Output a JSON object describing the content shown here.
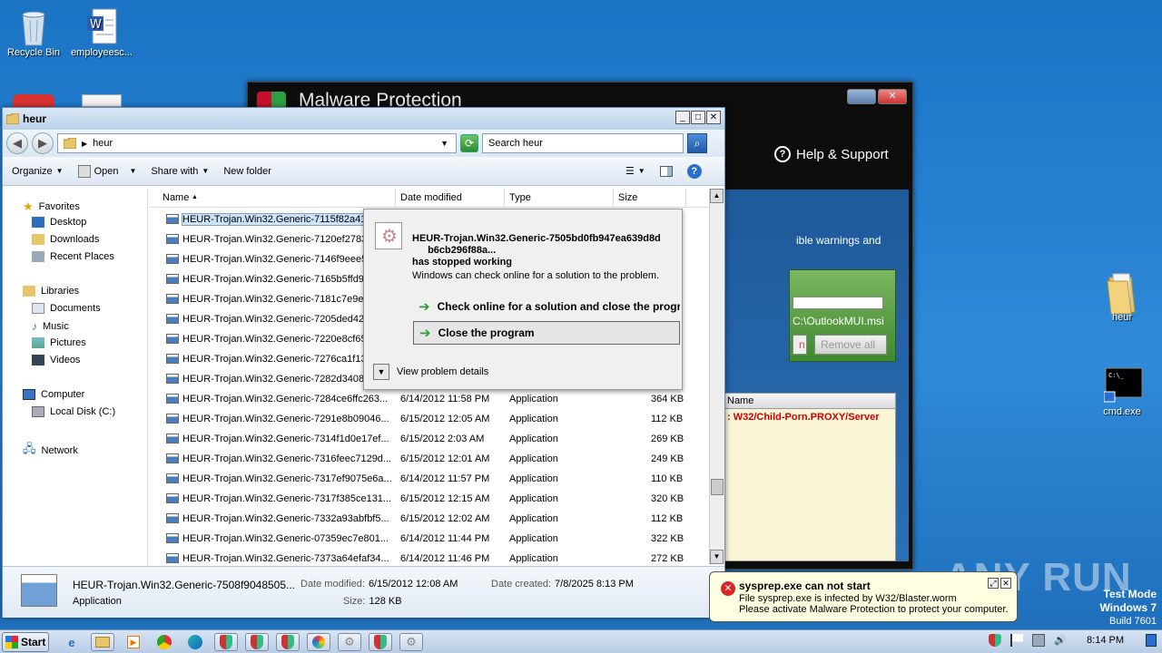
{
  "desktop": {
    "icons": [
      {
        "label": "Recycle Bin"
      },
      {
        "label": "employeesc..."
      },
      {
        "label": "heur"
      },
      {
        "label": "cmd.exe"
      }
    ]
  },
  "malware_window": {
    "title": "Malware Protection",
    "help": "Help & Support",
    "warning_text": "ible warnings and",
    "path_text": "C:\\OutlookMUI.msi",
    "btn_partial": "n",
    "btn_remove_all": "Remove all",
    "table_header": "Name",
    "threat_row": ": W32/Child-Porn.PROXY/Server"
  },
  "explorer": {
    "title": "heur",
    "address": "heur",
    "search_placeholder": "Search heur",
    "toolbar": {
      "organize": "Organize",
      "open": "Open",
      "share_with": "Share with",
      "new_folder": "New folder"
    },
    "nav": {
      "favorites": "Favorites",
      "desktop": "Desktop",
      "downloads": "Downloads",
      "recent_places": "Recent Places",
      "libraries": "Libraries",
      "documents": "Documents",
      "music": "Music",
      "pictures": "Pictures",
      "videos": "Videos",
      "computer": "Computer",
      "local_disk": "Local Disk (C:)",
      "network": "Network"
    },
    "columns": {
      "name": "Name",
      "date_modified": "Date modified",
      "type": "Type",
      "size": "Size"
    },
    "rows": [
      {
        "name": "HEUR-Trojan.Win32.Generic-7115f82a41",
        "date": "",
        "type": "",
        "size": ""
      },
      {
        "name": "HEUR-Trojan.Win32.Generic-7120ef2783",
        "date": "",
        "type": "",
        "size": ""
      },
      {
        "name": "HEUR-Trojan.Win32.Generic-7146f9eee5",
        "date": "",
        "type": "",
        "size": ""
      },
      {
        "name": "HEUR-Trojan.Win32.Generic-7165b5ffd9",
        "date": "",
        "type": "",
        "size": ""
      },
      {
        "name": "HEUR-Trojan.Win32.Generic-7181c7e9e7",
        "date": "",
        "type": "",
        "size": ""
      },
      {
        "name": "HEUR-Trojan.Win32.Generic-7205ded425",
        "date": "",
        "type": "",
        "size": ""
      },
      {
        "name": "HEUR-Trojan.Win32.Generic-7220e8cf65",
        "date": "",
        "type": "",
        "size": ""
      },
      {
        "name": "HEUR-Trojan.Win32.Generic-7276ca1f13",
        "date": "",
        "type": "",
        "size": ""
      },
      {
        "name": "HEUR-Trojan.Win32.Generic-7282d34084",
        "date": "",
        "type": "",
        "size": ""
      },
      {
        "name": "HEUR-Trojan.Win32.Generic-7284ce6ffc263...",
        "date": "6/14/2012 11:58 PM",
        "type": "Application",
        "size": "364 KB"
      },
      {
        "name": "HEUR-Trojan.Win32.Generic-7291e8b09046...",
        "date": "6/15/2012 12:05 AM",
        "type": "Application",
        "size": "112 KB"
      },
      {
        "name": "HEUR-Trojan.Win32.Generic-7314f1d0e17ef...",
        "date": "6/15/2012 2:03 AM",
        "type": "Application",
        "size": "269 KB"
      },
      {
        "name": "HEUR-Trojan.Win32.Generic-7316feec7129d...",
        "date": "6/15/2012 12:01 AM",
        "type": "Application",
        "size": "249 KB"
      },
      {
        "name": "HEUR-Trojan.Win32.Generic-7317ef9075e6a...",
        "date": "6/14/2012 11:57 PM",
        "type": "Application",
        "size": "110 KB"
      },
      {
        "name": "HEUR-Trojan.Win32.Generic-7317f385ce131...",
        "date": "6/15/2012 12:15 AM",
        "type": "Application",
        "size": "320 KB"
      },
      {
        "name": "HEUR-Trojan.Win32.Generic-7332a93abfbf5...",
        "date": "6/15/2012 12:02 AM",
        "type": "Application",
        "size": "112 KB"
      },
      {
        "name": "HEUR-Trojan.Win32.Generic-07359ec7e801...",
        "date": "6/14/2012 11:44 PM",
        "type": "Application",
        "size": "322 KB"
      },
      {
        "name": "HEUR-Trojan.Win32.Generic-7373a64efaf34...",
        "date": "6/14/2012 11:46 PM",
        "type": "Application",
        "size": "272 KB"
      }
    ],
    "details": {
      "filename": "HEUR-Trojan.Win32.Generic-7508f9048505...",
      "type": "Application",
      "date_modified_label": "Date modified:",
      "date_modified": "6/15/2012 12:08 AM",
      "date_created_label": "Date created:",
      "date_created": "7/8/2025 8:13 PM",
      "size_label": "Size:",
      "size": "128 KB"
    }
  },
  "error_dialog": {
    "title_line1": "HEUR-Trojan.Win32.Generic-7505bd0fb947ea639d8d",
    "title_line2": "b6cb296f88a...",
    "title_line3": "has stopped working",
    "message": "Windows can check online for a solution to the problem.",
    "option_check_online": "Check online for a solution and close the program",
    "option_close": "Close the program",
    "view_details": "View problem details"
  },
  "balloon": {
    "title": "sysprep.exe can not start",
    "line1": "File sysprep.exe is infected by W32/Blaster.worm",
    "line2": "Please activate Malware Protection to protect your computer."
  },
  "watermark": "ANY RUN",
  "test_mode": {
    "line1": "Test Mode",
    "line2": "Windows 7",
    "line3": "Build 7601"
  },
  "taskbar": {
    "start": "Start",
    "clock": "8:14 PM"
  }
}
